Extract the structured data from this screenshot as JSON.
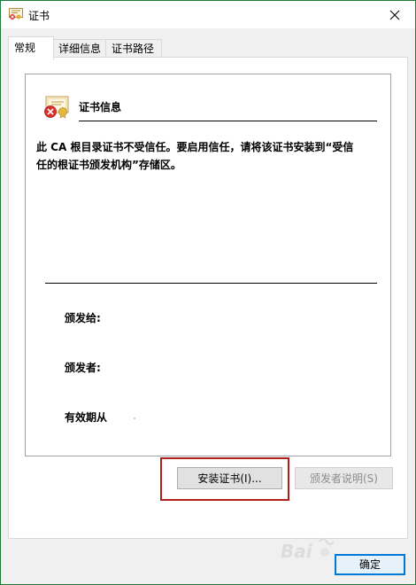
{
  "window": {
    "title": "证书",
    "close_symbol": "✕"
  },
  "tabs": [
    {
      "label": "常规",
      "active": true
    },
    {
      "label": "详细信息",
      "active": false
    },
    {
      "label": "证书路径",
      "active": false
    }
  ],
  "general": {
    "heading": "证书信息",
    "warning": "此 CA 根目录证书不受信任。要启用信任，请将该证书安装到“受信任的根证书颁发机构”存储区。",
    "fields": {
      "issued_to_label": "颁发给:",
      "issued_by_label": "颁发者:",
      "valid_from_label": "有效期从"
    }
  },
  "buttons": {
    "install": "安装证书(I)...",
    "issuer_statement": "颁发者说明(S)",
    "ok": "确定"
  },
  "icons": {
    "title_icon": "certificate-icon",
    "cert_icon": "certificate-untrusted-icon",
    "close": "close-icon"
  },
  "colors": {
    "window_border": "#1e7a3a",
    "highlight": "#b01e1e",
    "ok_border": "#0078d7",
    "cert_error": "#d9302c"
  }
}
